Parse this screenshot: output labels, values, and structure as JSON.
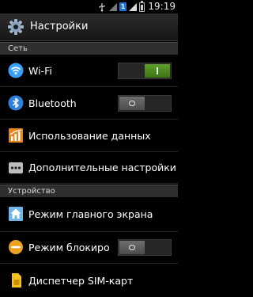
{
  "status_bar": {
    "time": "19:19",
    "sim_badge": "1",
    "icons": [
      "usb-icon",
      "signal-icon",
      "sim-icon",
      "signal-bars-icon",
      "battery-icon"
    ]
  },
  "header": {
    "title": "Настройки",
    "icon": "settings-gear-icon"
  },
  "sections": [
    {
      "title": "Сеть",
      "items": [
        {
          "label": "Wi-Fi",
          "icon": "wifi-icon",
          "toggle": "I",
          "toggle_on": true
        },
        {
          "label": "Bluetooth",
          "icon": "bluetooth-icon",
          "toggle": "O",
          "toggle_on": false
        },
        {
          "label": "Использование данных",
          "icon": "data-usage-icon"
        },
        {
          "label": "Дополнительные настройки",
          "icon": "more-icon"
        }
      ]
    },
    {
      "title": "Устройство",
      "items": [
        {
          "label": "Режим главного экрана",
          "icon": "home-icon"
        },
        {
          "label": "Режим блокировки",
          "icon": "block-icon",
          "toggle": "O",
          "toggle_on": false
        },
        {
          "label": "Диспетчер SIM-карт",
          "icon": "sim-card-icon"
        }
      ]
    }
  ],
  "colors": {
    "toggle_on": "#4a8a22",
    "toggle_off": "#5a5a5a",
    "section_header_bg": "#2f2f2f",
    "wifi_icon": "#3aa0ff",
    "bluetooth_icon": "#2f7fe0",
    "block_icon": "#f0a020",
    "sim_badge": "#1e74d6"
  }
}
